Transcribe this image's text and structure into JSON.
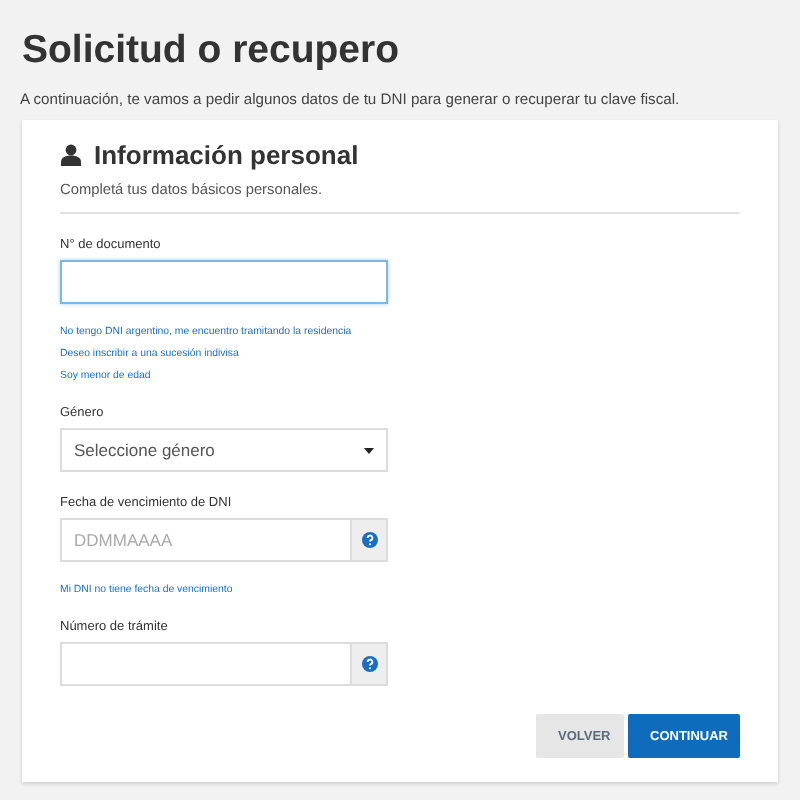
{
  "title": "Solicitud o recupero",
  "intro": "A continuación, te vamos a pedir algunos datos de tu DNI para generar o recuperar tu clave fiscal.",
  "section": {
    "title": "Información personal",
    "subtitle": "Completá tus datos básicos personales."
  },
  "fields": [
    {
      "kind": "text",
      "label": "N° de documento",
      "focused": true,
      "links": [
        "No tengo DNI argentino, me encuentro tramitando la residencia",
        "Deseo inscribir a una sucesión indivisa",
        "Soy menor de edad"
      ]
    },
    {
      "kind": "select",
      "label": "Género",
      "value": "Seleccione género",
      "focused": false
    },
    {
      "kind": "help",
      "label": "Fecha de vencimiento de DNI",
      "placeholder": "DDMMAAAA",
      "focused": false,
      "links": [
        "Mi DNI no tiene fecha de vencimiento"
      ]
    },
    {
      "kind": "help",
      "label": "Número de trámite",
      "focused": false
    }
  ],
  "buttons": [
    {
      "label": "VOLVER",
      "kind": "secondary"
    },
    {
      "label": "CONTINUAR",
      "kind": "primary"
    }
  ]
}
